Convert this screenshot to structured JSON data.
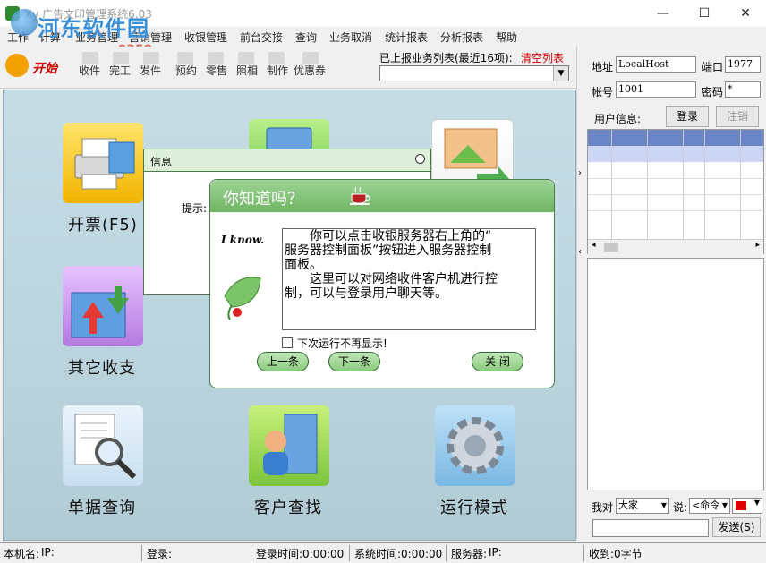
{
  "window": {
    "title": "Xy 广告文印管理系统6.03",
    "minimize_glyph": "—",
    "maximize_glyph": "☐",
    "close_glyph": "✕"
  },
  "watermark": {
    "name": "河东软件园",
    "url": "www.pc0359.cn"
  },
  "menu": [
    "工作",
    "计算",
    "业务管理",
    "营销管理",
    "收银管理",
    "前台交接",
    "查询",
    "业务取消",
    "统计报表",
    "分析报表",
    "帮助"
  ],
  "toolbar": {
    "start": "开始",
    "buttons": [
      "收件",
      "完工",
      "发件",
      "预约",
      "零售",
      "照相",
      "制作",
      "优惠券"
    ],
    "reported_label": "已上报业务列表(最近16项):",
    "clear_list": "清空列表",
    "reported_value": ""
  },
  "tiles": {
    "invoice": "开票(F5)",
    "other": "其它收支",
    "receipt_query": "单据查询",
    "customer_find": "客户查找",
    "run_mode": "运行模式"
  },
  "info_window": {
    "title": "信息",
    "prompt": "提示:"
  },
  "tip_dialog": {
    "title": "你知道吗？",
    "i_know": "I know.",
    "lines": [
      "　　你可以点击收银服务器右上角的“",
      "服务器控制面板”按钮进入服务器控制",
      "面板。",
      "　　这里可以对网络收件客户机进行控",
      "制，可以与登录用户聊天等。"
    ],
    "dont_show": "下次运行不再显示!",
    "prev": "上一条",
    "next": "下一条",
    "close": "关 闭"
  },
  "right_panel": {
    "address_label": "地址",
    "address_value": "LocalHost",
    "port_label": "端口",
    "port_value": "1977",
    "account_label": "帐号",
    "account_value": "1001",
    "password_label": "密码",
    "password_value": "*",
    "user_info_label": "用户信息:",
    "login": "登录",
    "logout": "注销",
    "i_to": "我对",
    "everyone": "大家",
    "say": "说:",
    "command": "<命令",
    "send": "发送(S)"
  },
  "status": {
    "local_name": "本机名:",
    "ip": "IP:",
    "login": "登录:",
    "login_time": "登录时间:0:00:00",
    "system_time": "系统时间:0:00:00",
    "server": "服务器:",
    "server_ip": "IP:",
    "received": "收到:0字节"
  },
  "colors": {
    "accent_red": "#cc0000",
    "dialog_green": "#8ccc80",
    "main_bg": "#c6dde6"
  }
}
